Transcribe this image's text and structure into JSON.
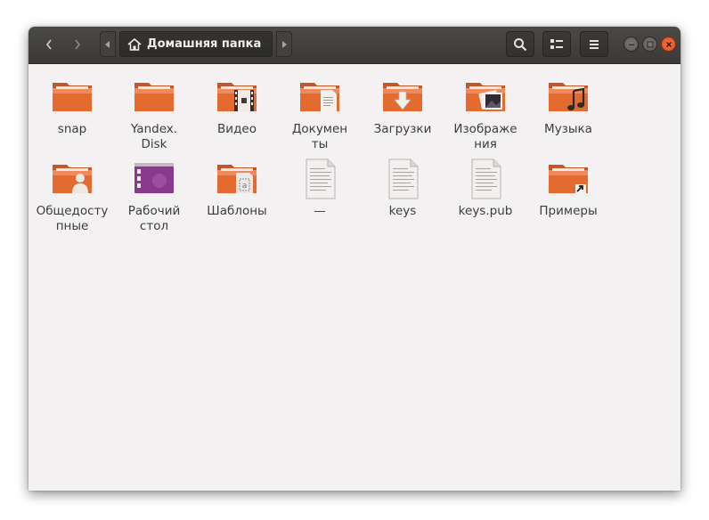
{
  "header": {
    "path_label": "Домашняя папка",
    "icons": {
      "back": "chevron-left-icon",
      "forward": "chevron-right-icon",
      "home": "home-icon",
      "search": "search-icon",
      "view": "list-view-icon",
      "menu": "hamburger-menu-icon",
      "minimize": "minimize-icon",
      "maximize": "maximize-icon",
      "close": "close-icon"
    }
  },
  "items": [
    {
      "label": "snap",
      "kind": "folder",
      "emblem": "none"
    },
    {
      "label": "Yandex.\nDisk",
      "kind": "folder",
      "emblem": "none"
    },
    {
      "label": "Видео",
      "kind": "folder",
      "emblem": "video"
    },
    {
      "label": "Докумен\nты",
      "kind": "folder",
      "emblem": "document"
    },
    {
      "label": "Загрузки",
      "kind": "folder",
      "emblem": "download"
    },
    {
      "label": "Изображе\nния",
      "kind": "folder",
      "emblem": "picture"
    },
    {
      "label": "Музыка",
      "kind": "folder",
      "emblem": "music"
    },
    {
      "label": "Общедосту\nпные",
      "kind": "folder",
      "emblem": "public"
    },
    {
      "label": "Рабочий\nстол",
      "kind": "desktop",
      "emblem": "none"
    },
    {
      "label": "Шаблоны",
      "kind": "folder",
      "emblem": "template"
    },
    {
      "label": "—",
      "kind": "file",
      "emblem": "none"
    },
    {
      "label": "keys",
      "kind": "file",
      "emblem": "none"
    },
    {
      "label": "keys.pub",
      "kind": "file",
      "emblem": "none"
    },
    {
      "label": "Примеры",
      "kind": "folder",
      "emblem": "link"
    }
  ],
  "colors": {
    "folder_top": "#f08a5d",
    "folder_body": "#e46b30",
    "desktop": "#8a3a8c"
  }
}
